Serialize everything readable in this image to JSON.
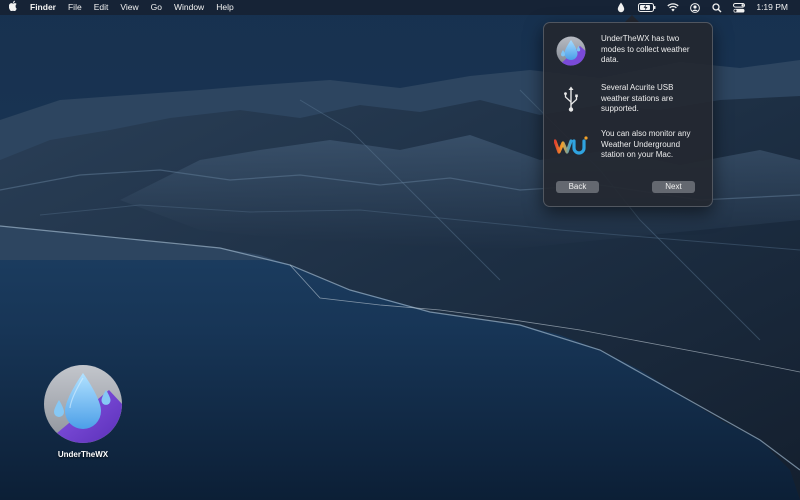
{
  "menubar": {
    "apple_icon": "apple-logo-icon",
    "app_name": "Finder",
    "menus": [
      "File",
      "Edit",
      "View",
      "Go",
      "Window",
      "Help"
    ],
    "status_icons": [
      "raindrop-icon",
      "battery-charging-icon",
      "wifi-icon",
      "user-icon",
      "search-icon",
      "control-center-icon"
    ],
    "clock": "1:19 PM"
  },
  "popover": {
    "items": [
      {
        "icon": "underthewx-app-icon",
        "text": "UnderTheWX has two modes to collect weather data."
      },
      {
        "icon": "usb-icon",
        "text": "Several Acurite USB weather stations are supported."
      },
      {
        "icon": "weather-underground-logo-icon",
        "text": "You can also monitor any Weather Underground station on your Mac."
      }
    ],
    "back_label": "Back",
    "next_label": "Next"
  },
  "desktop": {
    "icon_label": "UnderTheWX"
  },
  "colors": {
    "menubar_bg": "#161e2c",
    "popover_bg": "#242830",
    "button_bg": "#646870",
    "app_icon_purple": "#7a4ad8",
    "app_icon_drop": "#6ab8f0"
  }
}
